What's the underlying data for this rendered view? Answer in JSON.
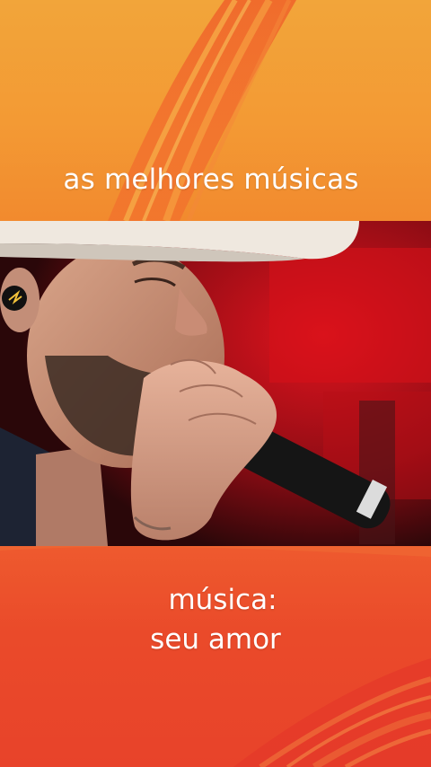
{
  "header": {
    "headline": "as melhores músicas"
  },
  "song": {
    "label": "música:",
    "title": "seu amor"
  },
  "colors": {
    "top_banner": "#f39a34",
    "bottom_banner": "#e8432a",
    "stage_red": "#c0111a",
    "text": "#ffffff"
  },
  "photo": {
    "subject": "singer-with-hat-and-microphone"
  }
}
